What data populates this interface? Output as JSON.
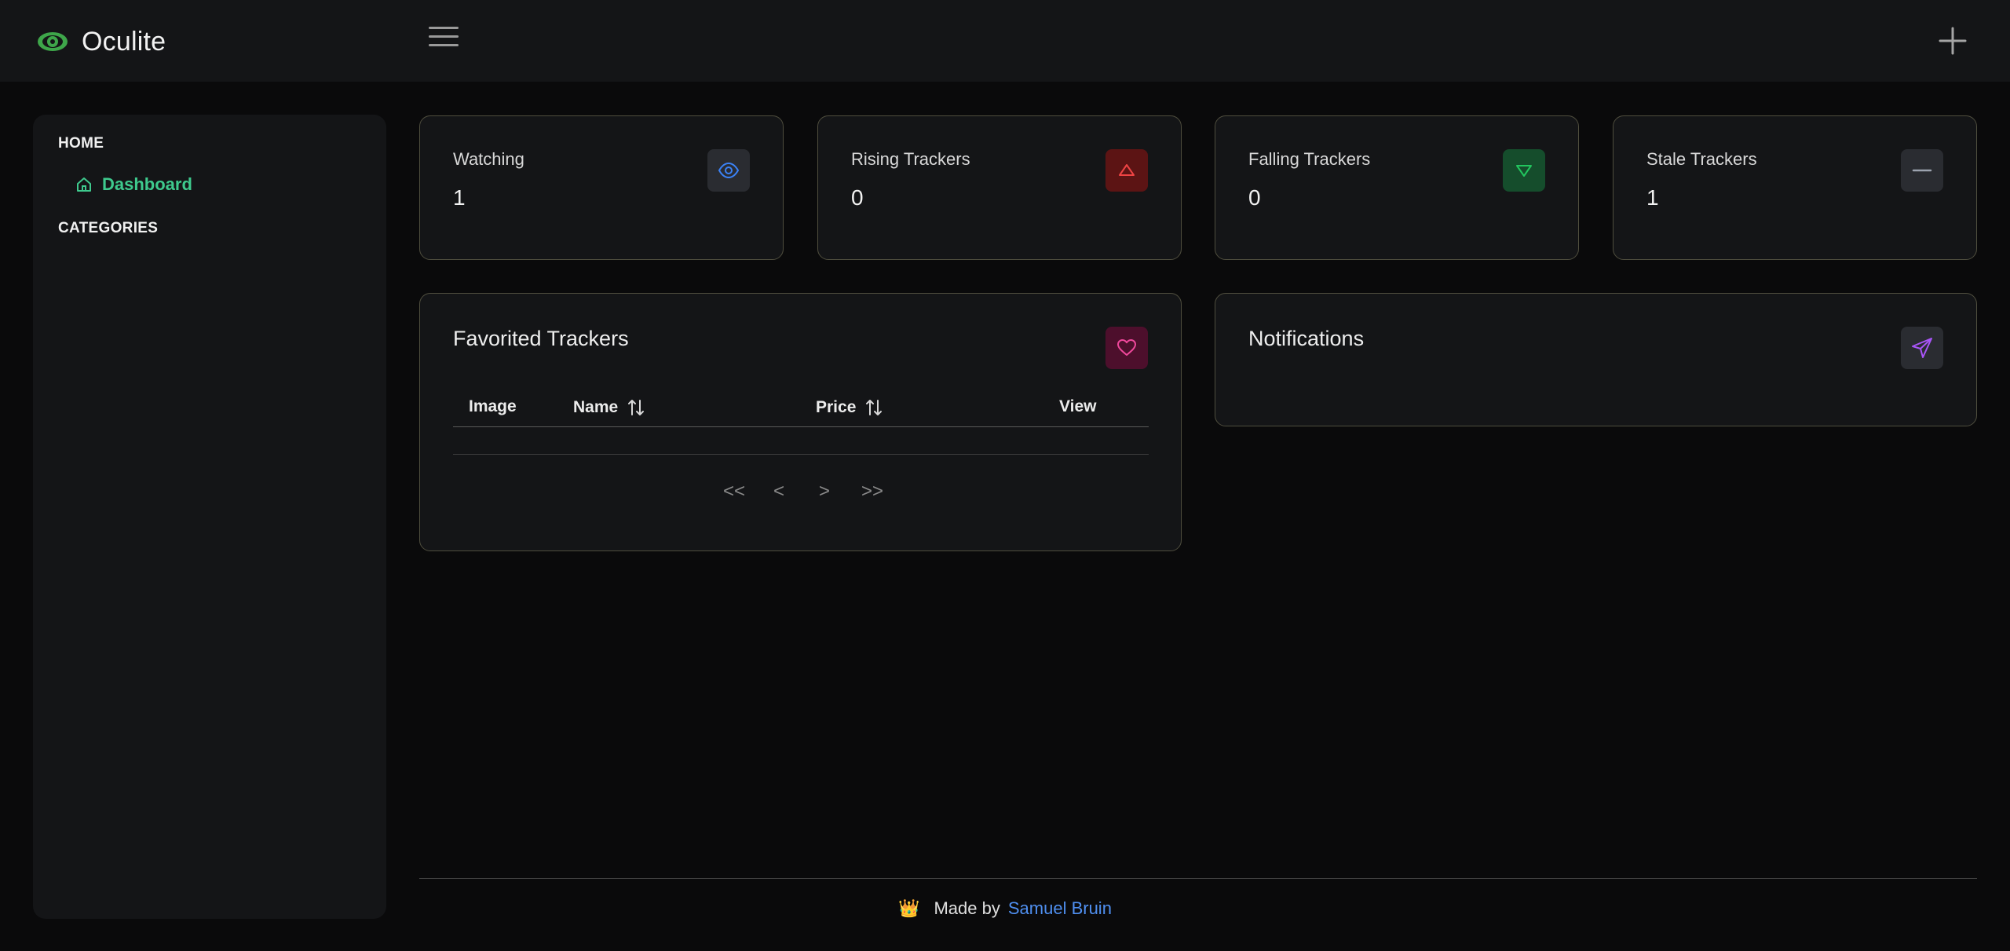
{
  "app": {
    "name": "Oculite"
  },
  "sidebar": {
    "home_heading": "HOME",
    "items": [
      {
        "label": "Dashboard",
        "icon": "home-icon"
      }
    ],
    "categories_heading": "CATEGORIES"
  },
  "stats": [
    {
      "title": "Watching",
      "value": "1",
      "icon": "eye-icon",
      "color": "#3b82f6"
    },
    {
      "title": "Rising Trackers",
      "value": "0",
      "icon": "triangle-up-icon",
      "color": "#ef4444"
    },
    {
      "title": "Falling Trackers",
      "value": "0",
      "icon": "triangle-down-icon",
      "color": "#22c55e"
    },
    {
      "title": "Stale Trackers",
      "value": "1",
      "icon": "minus-icon",
      "color": "#9ca3af"
    }
  ],
  "favorites": {
    "title": "Favorited Trackers",
    "icon": "heart-icon",
    "columns": [
      "Image",
      "Name",
      "Price",
      "View"
    ],
    "pager": [
      "<<",
      "<",
      ">",
      ">>"
    ]
  },
  "notifications": {
    "title": "Notifications",
    "icon": "send-icon"
  },
  "footer": {
    "crown": "👑",
    "text": "Made by",
    "author": "Samuel Bruin"
  },
  "colors": {
    "accent": "#3ec98d",
    "link": "#4f8ff0",
    "background": "#0a0a0b",
    "panel": "#141517"
  }
}
